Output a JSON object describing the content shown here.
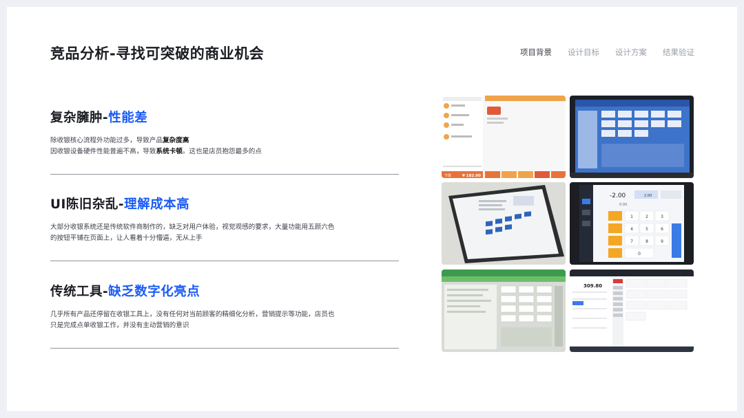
{
  "header": {
    "title": "竞品分析-寻找可突破的商业机会",
    "nav": [
      "项目背景",
      "设计目标",
      "设计方案",
      "结果验证"
    ],
    "active_nav": "项目背景"
  },
  "sections": [
    {
      "title_main": "复杂臃肿-",
      "title_highlight": "性能差",
      "line1_a": "除收银核心流程外功能过多，导致产品",
      "line1_b": "复杂度高",
      "line2_a": "因收银设备硬件性能普遍不高，导致",
      "line2_b": "系统卡顿",
      "line2_c": "。这也是店员抱怨最多的点"
    },
    {
      "title_main": "UI陈旧杂乱-",
      "title_highlight": "理解成本高",
      "line1": "大部分收银系统还是传统软件商制作的，缺乏对用户体验，视觉观感的要求，大量功能用五颜六色",
      "line2": "的按钮平铺在页面上，让人看着十分懵逼，无从上手"
    },
    {
      "title_main": "传统工具-",
      "title_highlight": "缺乏数字化亮点",
      "line1": "几乎所有产品还停留在收银工具上，没有任何对当前顾客的精细化分析，营销提示等功能，店员也",
      "line2": "只是完成点单收银工作，并没有主动营销的意识"
    }
  ],
  "screenshots": {
    "shot1": {
      "price": "¥ 182.00",
      "btn": "下单"
    },
    "shot4": {
      "amount": "-2.00",
      "v1": "2.00",
      "v2": "0.00",
      "keys": [
        "1",
        "2",
        "3",
        "4",
        "5",
        "6",
        "7",
        "8",
        "9",
        "0"
      ]
    },
    "shot6": {
      "amount": "309.80"
    }
  },
  "colors": {
    "accent": "#1a5bf5",
    "title": "#1a1c22",
    "body_text": "#3d4048",
    "nav_inactive": "#9aa0ab",
    "background": "#eef0f5"
  }
}
